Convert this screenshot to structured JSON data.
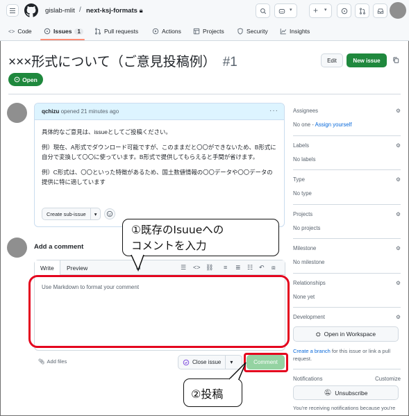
{
  "repo": {
    "owner": "gislab-mlit",
    "name": "next-ksj-formats"
  },
  "tabs": [
    {
      "label": "Code"
    },
    {
      "label": "Issues",
      "count": "1"
    },
    {
      "label": "Pull requests"
    },
    {
      "label": "Actions"
    },
    {
      "label": "Projects"
    },
    {
      "label": "Security"
    },
    {
      "label": "Insights"
    }
  ],
  "issue": {
    "title": "×××形式について（ご意見投稿例）",
    "number": "#1",
    "state": "Open",
    "edit_label": "Edit",
    "new_issue_label": "New issue"
  },
  "comment": {
    "author": "qchizu",
    "time": "opened 21 minutes ago",
    "paragraphs": [
      "具体的なご意見は、issueとしてご投稿ください。",
      "例）現在、A形式でダウンロード可能ですが、このままだと〇〇ができないため、B形式に自分で変換して〇〇に使っています。B形式で提供してもらえると手間が省けます。",
      "例）C形式は、〇〇といった特徴があるため、国土数値情報の〇〇データや〇〇データの提供に特に適しています"
    ],
    "sub_issue_label": "Create sub-issue"
  },
  "add_comment": {
    "title": "Add a comment",
    "tab_write": "Write",
    "tab_preview": "Preview",
    "placeholder": "Use Markdown to format your comment",
    "paste_label": "Add files",
    "close_label": "Close issue",
    "comment_label": "Comment"
  },
  "callouts": {
    "one_line1": "①既存のIsuueへの",
    "one_line2": "コメントを入力",
    "two": "②投稿"
  },
  "sidebar": {
    "assignees": {
      "label": "Assignees",
      "none": "No one - ",
      "link": "Assign yourself"
    },
    "labels": {
      "label": "Labels",
      "value": "No labels"
    },
    "type": {
      "label": "Type",
      "value": "No type"
    },
    "projects": {
      "label": "Projects",
      "value": "No projects"
    },
    "milestone": {
      "label": "Milestone",
      "value": "No milestone"
    },
    "relationships": {
      "label": "Relationships",
      "value": "None yet"
    },
    "development": {
      "label": "Development",
      "button": "Open in Workspace",
      "link": "Create a branch",
      "rest": " for this issue or link a pull request."
    },
    "notifications": {
      "label": "Notifications",
      "customize": "Customize",
      "button": "Unsubscribe",
      "note": "You're receiving notifications because you're"
    }
  },
  "colors": {
    "green": "#1f883d",
    "highlight_red": "#e4051e",
    "link_blue": "#0969da"
  }
}
